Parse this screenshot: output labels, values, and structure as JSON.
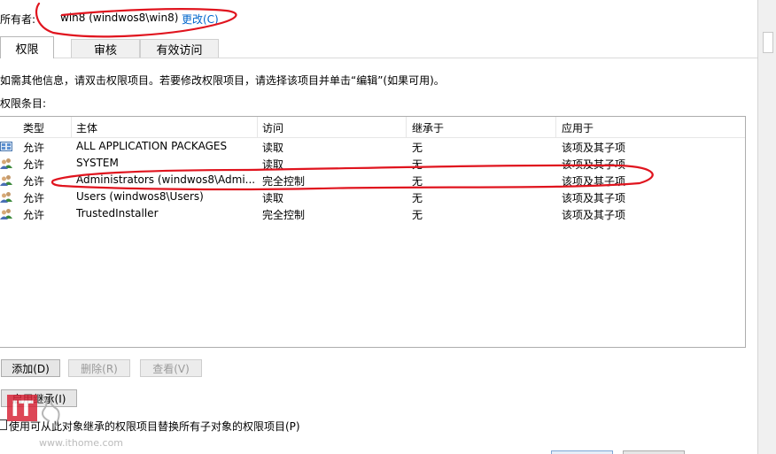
{
  "owner": {
    "label": "所有者:",
    "value": "win8 (windwos8\\win8)",
    "change_link": "更改(C)"
  },
  "tabs": [
    {
      "label": "权限",
      "active": true
    },
    {
      "label": "审核",
      "active": false
    },
    {
      "label": "有效访问",
      "active": false
    }
  ],
  "info_text": "如需其他信息，请双击权限项目。若要修改权限项目，请选择该项目并单击“编辑”(如果可用)。",
  "entries_label": "权限条目:",
  "table": {
    "headers": [
      "类型",
      "主体",
      "访问",
      "继承于",
      "应用于"
    ],
    "rows": [
      {
        "type": "允许",
        "principal": "ALL APPLICATION PACKAGES",
        "access": "读取",
        "inherited": "无",
        "applies": "该项及其子项",
        "icon": "package-icon"
      },
      {
        "type": "允许",
        "principal": "SYSTEM",
        "access": "读取",
        "inherited": "无",
        "applies": "该项及其子项",
        "icon": "users-icon"
      },
      {
        "type": "允许",
        "principal": "Administrators (windwos8\\Admi...",
        "access": "完全控制",
        "inherited": "无",
        "applies": "该项及其子项",
        "icon": "users-icon"
      },
      {
        "type": "允许",
        "principal": "Users (windwos8\\Users)",
        "access": "读取",
        "inherited": "无",
        "applies": "该项及其子项",
        "icon": "users-icon"
      },
      {
        "type": "允许",
        "principal": "TrustedInstaller",
        "access": "完全控制",
        "inherited": "无",
        "applies": "该项及其子项",
        "icon": "users-icon"
      }
    ]
  },
  "buttons": {
    "add": "添加(D)",
    "remove": "删除(R)",
    "view": "查看(V)",
    "enable_inheritance": "启用继承(I)"
  },
  "replace_checkbox": {
    "label": "使用可从此对象继承的权限项目替换所有子对象的权限项目(P)",
    "checked": false
  },
  "watermark": {
    "logo_text": "IT",
    "site": "www.ithome.com"
  },
  "colors": {
    "link": "#0066cc",
    "annotation": "#e0141e",
    "watermark": "#d8273a"
  }
}
